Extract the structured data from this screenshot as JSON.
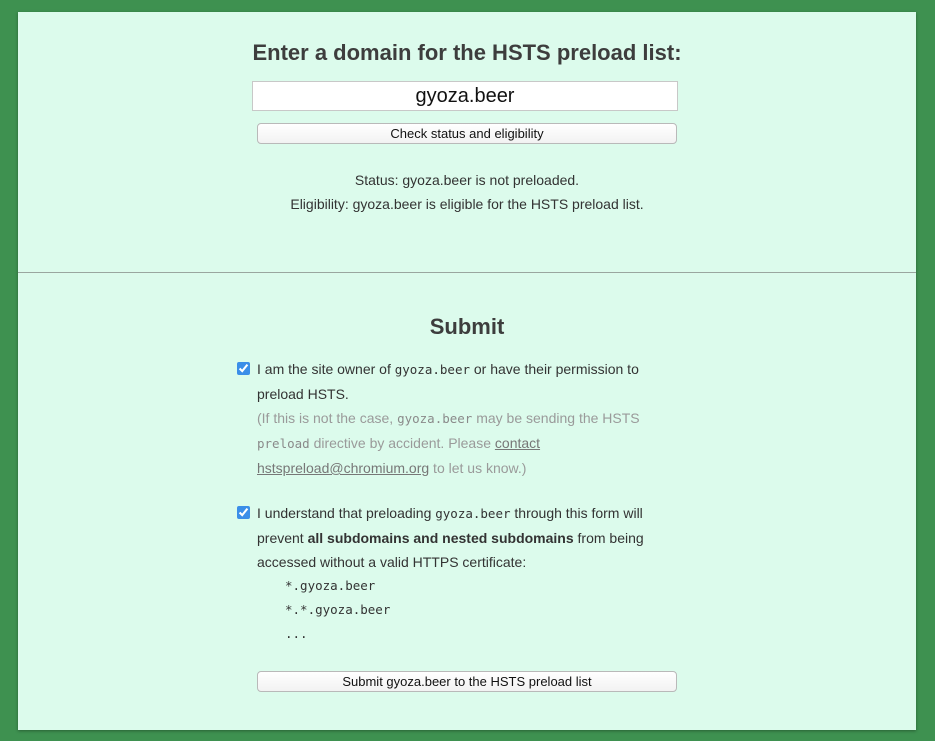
{
  "lookup": {
    "heading": "Enter a domain for the HSTS preload list:",
    "domain_value": "gyoza.beer",
    "check_button": "Check status and eligibility",
    "status_text": "Status: gyoza.beer is not preloaded.",
    "eligibility_text": "Eligibility: gyoza.beer is eligible for the HSTS preload list."
  },
  "submit_section": {
    "heading": "Submit",
    "owner_checkbox": {
      "checked": true,
      "text_before": "I am the site owner of ",
      "domain": "gyoza.beer",
      "text_after": " or have their permission to preload HSTS.",
      "note_before": "(If this is not the case, ",
      "note_domain": "gyoza.beer",
      "note_middle": " may be sending the HSTS ",
      "note_code": "preload",
      "note_after": " directive by accident. Please ",
      "contact_link": "contact",
      "email_link": "hstspreload@chromium.org",
      "note_end": " to let us know.)"
    },
    "subdomain_checkbox": {
      "checked": true,
      "text_before": "I understand that preloading ",
      "domain": "gyoza.beer",
      "text_middle": " through this form will prevent ",
      "bold_text": "all subdomains and nested subdomains",
      "text_after": " from being accessed without a valid HTTPS certificate:",
      "examples": [
        "*.gyoza.beer",
        "*.*.gyoza.beer",
        "..."
      ]
    },
    "submit_button": "Submit gyoza.beer to the HSTS preload list"
  },
  "colors": {
    "page_background": "#3e9150",
    "card_background": "#dcfbec",
    "checkbox_accent": "#3b8ee8"
  }
}
